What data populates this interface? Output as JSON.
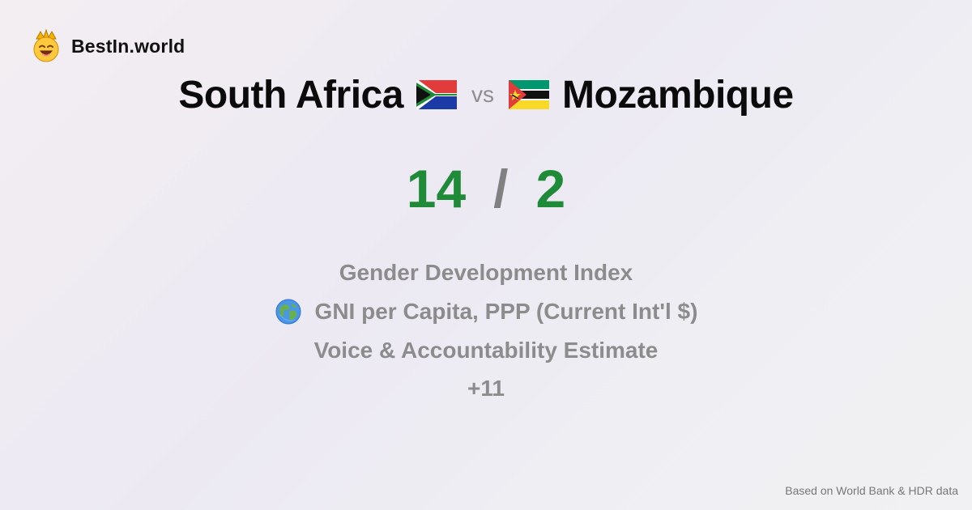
{
  "brand": {
    "name": "BestIn.world",
    "logo_icon": "crown-smiley-icon"
  },
  "comparison": {
    "left_country": "South Africa",
    "left_flag_icon": "south-africa-flag-icon",
    "vs_label": "vs",
    "right_country": "Mozambique",
    "right_flag_icon": "mozambique-flag-icon"
  },
  "scores": {
    "left": "14",
    "separator": "/",
    "right": "2"
  },
  "metrics": [
    {
      "label": "Gender Development Index",
      "icon": ""
    },
    {
      "label": "GNI per Capita, PPP (Current Int'l $)",
      "icon": "globe-icon"
    },
    {
      "label": "Voice & Accountability Estimate",
      "icon": ""
    }
  ],
  "more_label": "+11",
  "footer": {
    "source": "Based on World Bank & HDR data"
  },
  "colors": {
    "score_green": "#1f8a38",
    "muted_gray": "#8c8c8c",
    "title_black": "#0b0b0b"
  }
}
